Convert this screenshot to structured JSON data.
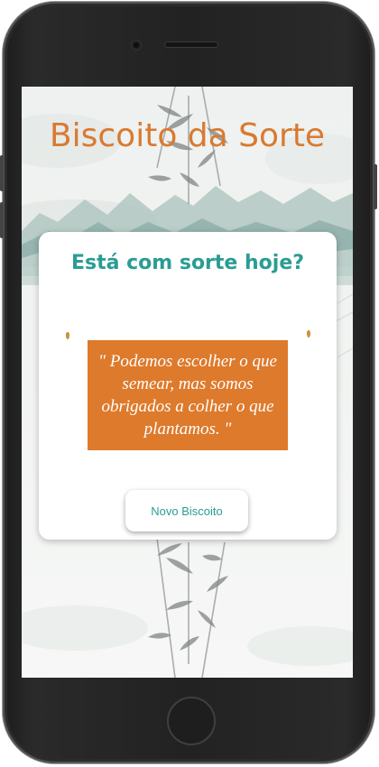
{
  "page": {
    "title": "Biscoito da Sorte"
  },
  "card": {
    "heading": "Está com sorte hoje?",
    "fortune": "\" Podemos escolher o que semear, mas somos obrigados a colher o que plantamos. \"",
    "button_label": "Novo Biscoito"
  },
  "colors": {
    "title": "#d97a31",
    "accent": "#2a9d93",
    "fortune_bg": "#de7a2c",
    "crumb": "#c9933f"
  },
  "icons": {
    "background": "ink-landscape-bamboo-art",
    "crumbs": "cookie-crumb-icon"
  }
}
